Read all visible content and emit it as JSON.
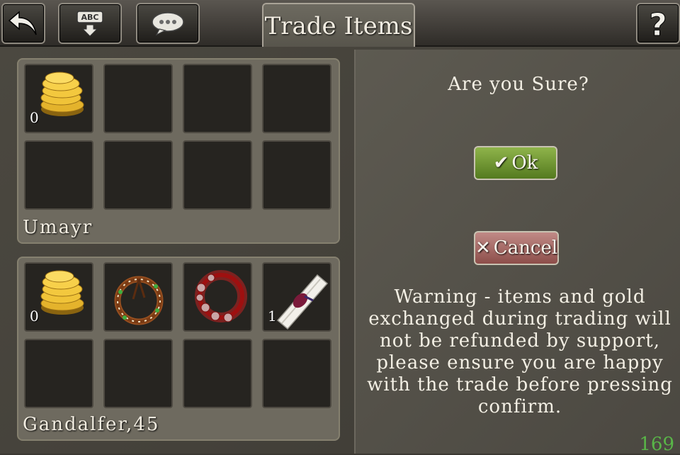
{
  "header": {
    "back_icon": "back-arrow-icon",
    "keyboard_icon": "keyboard-abc-icon",
    "keyboard_label": "ABC",
    "chat_icon": "chat-bubble-icon",
    "title": "Trade Items",
    "help_icon": "help-question-icon",
    "help_label": "?"
  },
  "top_panel": {
    "player_name": "Umayr",
    "slots": [
      {
        "item": "gold-coins-icon",
        "count": "0"
      },
      {
        "item": null,
        "count": ""
      },
      {
        "item": null,
        "count": ""
      },
      {
        "item": null,
        "count": ""
      },
      {
        "item": null,
        "count": ""
      },
      {
        "item": null,
        "count": ""
      },
      {
        "item": null,
        "count": ""
      },
      {
        "item": null,
        "count": ""
      }
    ]
  },
  "bottom_panel": {
    "player_name": "Gandalfer,45",
    "slots": [
      {
        "item": "gold-coins-icon",
        "count": "0"
      },
      {
        "item": "thorn-ring-necklace-icon",
        "count": ""
      },
      {
        "item": "red-bead-necklace-icon",
        "count": ""
      },
      {
        "item": "scroll-icon",
        "count": "1"
      },
      {
        "item": null,
        "count": ""
      },
      {
        "item": null,
        "count": ""
      },
      {
        "item": null,
        "count": ""
      },
      {
        "item": null,
        "count": ""
      }
    ]
  },
  "dialog": {
    "question": "Are you Sure?",
    "ok_label": "Ok",
    "ok_icon": "checkmark-icon",
    "cancel_label": "Cancel",
    "cancel_icon": "x-icon",
    "warning": "Warning - items and gold exchanged during trading will not be refunded by support, please ensure you are happy with the trade before pressing confirm.",
    "counter": "169"
  },
  "colors": {
    "ok_button": "#7aa03a",
    "cancel_button": "#a56a66",
    "counter_text": "#59b548"
  }
}
